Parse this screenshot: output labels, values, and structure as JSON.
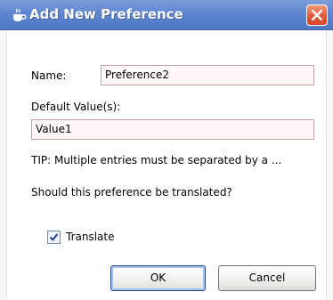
{
  "window": {
    "title": "Add New Preference",
    "title_icon": "coffee-cup-icon",
    "close_icon": "close-icon"
  },
  "form": {
    "name_label": "Name:",
    "name_value": "Preference2",
    "default_label": "Default Value(s):",
    "default_value": "Value1",
    "tip": "TIP: Multiple entries must be separated by a ...",
    "question": "Should this preference be translated?",
    "translate_label": "Translate",
    "translate_checked": true
  },
  "buttons": {
    "ok": "OK",
    "cancel": "Cancel"
  },
  "colors": {
    "titlebar": "#5f86d0",
    "close_button": "#e2583a",
    "input_bg": "#fff7f7",
    "input_border": "#c9a3a3"
  }
}
